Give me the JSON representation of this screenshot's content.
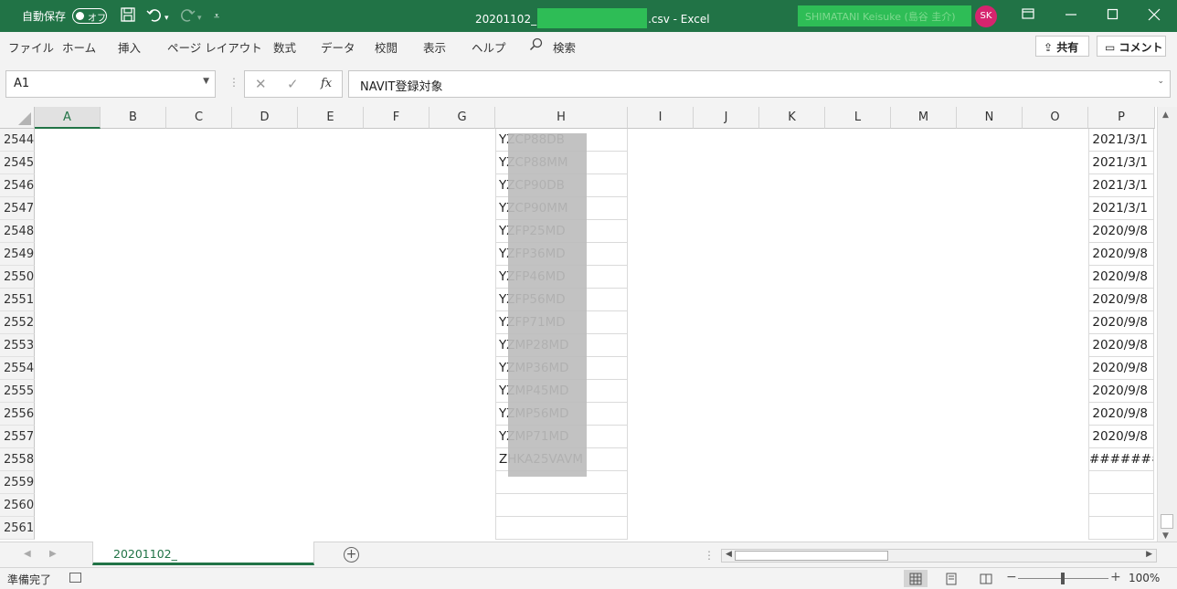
{
  "titlebar": {
    "autosave_label": "自動保存",
    "autosave_state": "オフ",
    "title_prefix": "20201102_",
    "title_suffix": ".csv  -  Excel",
    "user_name": "SHIMATANI Keisuke (島谷 圭介)",
    "avatar_initials": "SK",
    "save_icon": "save-icon",
    "undo_icon": "undo-icon",
    "redo_icon": "redo-icon"
  },
  "menu": {
    "tabs": [
      "ファイル",
      "ホーム",
      "挿入",
      "ページ レイアウト",
      "数式",
      "データ",
      "校閲",
      "表示",
      "ヘルプ"
    ],
    "search_label": "検索",
    "share_label": "共有",
    "comment_label": "コメント"
  },
  "formula_bar": {
    "name_box": "A1",
    "fx_label": "fx",
    "formula": "NAVIT登録対象"
  },
  "grid": {
    "columns": [
      "A",
      "B",
      "C",
      "D",
      "E",
      "F",
      "G",
      "H",
      "I",
      "J",
      "K",
      "L",
      "M",
      "N",
      "O",
      "P"
    ],
    "selected_column": "A",
    "rows": [
      {
        "num": "2544",
        "h": "YZCP88DB",
        "p": "2021/3/1"
      },
      {
        "num": "2545",
        "h": "YZCP88MM",
        "p": "2021/3/1"
      },
      {
        "num": "2546",
        "h": "YZCP90DB",
        "p": "2021/3/1"
      },
      {
        "num": "2547",
        "h": "YZCP90MM",
        "p": "2021/3/1"
      },
      {
        "num": "2548",
        "h": "YZFP25MD",
        "p": "2020/9/8"
      },
      {
        "num": "2549",
        "h": "YZFP36MD",
        "p": "2020/9/8"
      },
      {
        "num": "2550",
        "h": "YZFP46MD",
        "p": "2020/9/8"
      },
      {
        "num": "2551",
        "h": "YZFP56MD",
        "p": "2020/9/8"
      },
      {
        "num": "2552",
        "h": "YZFP71MD",
        "p": "2020/9/8"
      },
      {
        "num": "2553",
        "h": "YZMP28MD",
        "p": "2020/9/8"
      },
      {
        "num": "2554",
        "h": "YZMP36MD",
        "p": "2020/9/8"
      },
      {
        "num": "2555",
        "h": "YZMP45MD",
        "p": "2020/9/8"
      },
      {
        "num": "2556",
        "h": "YZMP56MD",
        "p": "2020/9/8"
      },
      {
        "num": "2557",
        "h": "YZMP71MD",
        "p": "2020/9/8"
      },
      {
        "num": "2558",
        "h": "ZHKA25VAVM",
        "p": "#######"
      },
      {
        "num": "2559",
        "h": "",
        "p": ""
      },
      {
        "num": "2560",
        "h": "",
        "p": ""
      },
      {
        "num": "2561",
        "h": "",
        "p": ""
      }
    ]
  },
  "sheets": {
    "active_tab": "20201102_"
  },
  "status": {
    "ready": "準備完了",
    "zoom": "100%"
  },
  "colors": {
    "excel_green": "#217346",
    "redaction_green": "#2ebd56",
    "avatar_pink": "#d6246e"
  }
}
